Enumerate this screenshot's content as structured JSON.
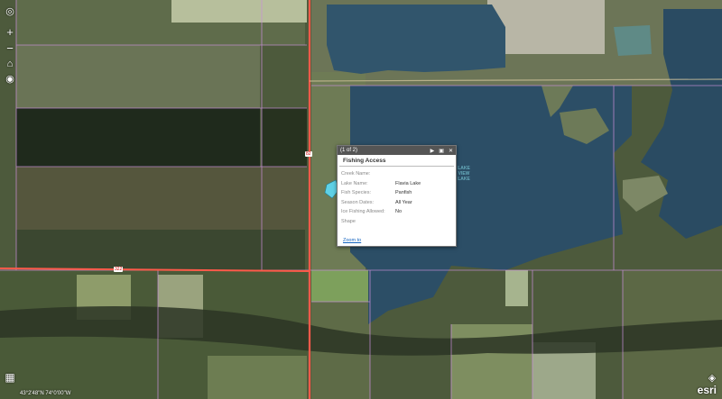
{
  "map": {
    "colors": {
      "water": "#2c4e66",
      "field_light": "#b9c2a4",
      "forest": "#2f3a28",
      "road": "#ff5a4a",
      "parcel": "#c88fd8"
    },
    "road_labels": [
      "82",
      "322"
    ],
    "lake_label": "LAKE\nVIEW\nLAKE",
    "coordinates": "43°2'48\"N  74°0'00\"W"
  },
  "controls": {
    "home_icon": "home-icon",
    "zoom_in_icon": "plus-icon",
    "zoom_out_icon": "minus-icon",
    "locate_icon": "locate-icon",
    "basemap_icon": "grid-icon",
    "layers_icon": "layers-icon"
  },
  "popup": {
    "counter": "(1 of 2)",
    "title": "Fishing Access",
    "fields": [
      {
        "label": "Creek Name:",
        "value": ""
      },
      {
        "label": "Lake Name:",
        "value": "Flavia Lake"
      },
      {
        "label": "Fish Species:",
        "value": "Panfish"
      },
      {
        "label": "Season Dates:",
        "value": "All Year"
      },
      {
        "label": "Ice Fishing Allowed:",
        "value": "No"
      },
      {
        "label": "Shape",
        "value": ""
      }
    ],
    "zoom_link": "Zoom to"
  },
  "brand": "esri"
}
